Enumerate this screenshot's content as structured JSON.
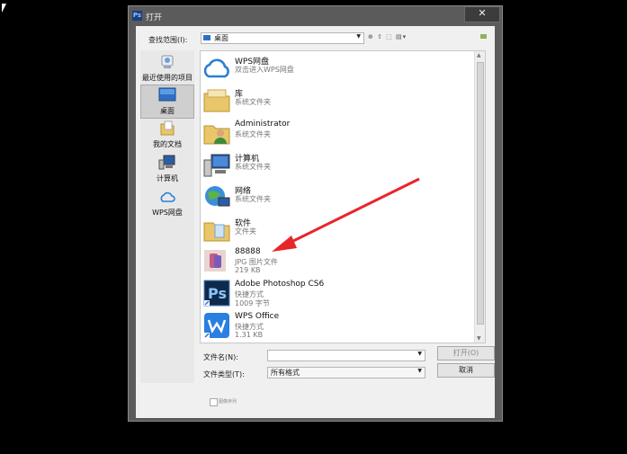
{
  "dialog": {
    "title": "打开",
    "app_icon": "Ps",
    "close_symbol": "✕",
    "look_in_label": "查找范围(I):",
    "look_in_value": "桌面",
    "toolbar_icons": "⊕ ⇧ ⬚ ▤▾"
  },
  "places": [
    {
      "label": "最近使用的项目",
      "icon": "recent-icon"
    },
    {
      "label": "桌面",
      "icon": "desktop-icon"
    },
    {
      "label": "我的文档",
      "icon": "documents-icon"
    },
    {
      "label": "计算机",
      "icon": "computer-icon"
    },
    {
      "label": "WPS网盘",
      "icon": "cloud-icon"
    }
  ],
  "files": [
    {
      "name": "WPS网盘",
      "line2": "双击进入WPS网盘",
      "line3": "",
      "icon": "cloud-icon"
    },
    {
      "name": "库",
      "line2": "系统文件夹",
      "line3": "",
      "icon": "library-folder-icon"
    },
    {
      "name": "Administrator",
      "line2": "系统文件夹",
      "line3": "",
      "icon": "user-folder-icon"
    },
    {
      "name": "计算机",
      "line2": "系统文件夹",
      "line3": "",
      "icon": "computer-icon"
    },
    {
      "name": "网络",
      "line2": "系统文件夹",
      "line3": "",
      "icon": "network-icon"
    },
    {
      "name": "软件",
      "line2": "文件夹",
      "line3": "",
      "icon": "folder-icon"
    },
    {
      "name": "88888",
      "line2": "JPG 图片文件",
      "line3": "219 KB",
      "icon": "image-thumbnail-icon"
    },
    {
      "name": "Adobe Photoshop CS6",
      "line2": "快捷方式",
      "line3": "1009 字节",
      "icon": "photoshop-icon"
    },
    {
      "name": "WPS Office",
      "line2": "快捷方式",
      "line3": "1.31 KB",
      "icon": "wps-icon"
    }
  ],
  "form": {
    "filename_label": "文件名(N):",
    "filename_value": "",
    "filetype_label": "文件类型(T):",
    "filetype_value": "所有格式",
    "open_button": "打开(O)",
    "cancel_button": "取消",
    "sequence_label": "图像序列"
  },
  "colors": {
    "arrow": "#e8262a",
    "desktop_blue": "#2f6fc4"
  }
}
